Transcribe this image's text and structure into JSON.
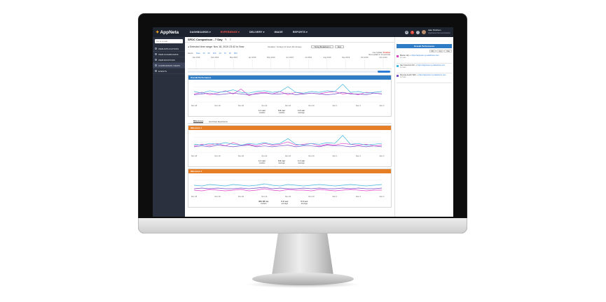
{
  "app": {
    "name": "AppNeta"
  },
  "nav": {
    "items": [
      {
        "label": "DASHBOARDS ▾",
        "active": false
      },
      {
        "label": "EXPERIENCE ▾",
        "active": true
      },
      {
        "label": "DELIVERY ▾",
        "active": false
      },
      {
        "label": "IMAGE",
        "active": false
      },
      {
        "label": "REPORTS ▾",
        "active": false
      }
    ],
    "user_name": "Alan Pinkham",
    "user_org": "AppNeta Demonstration"
  },
  "sidebar": {
    "search_placeholder": "Go to a web...",
    "items": [
      {
        "label": "WEB APPLICATIONS",
        "active": false
      },
      {
        "label": "WEB DASHBOARDS",
        "active": false
      },
      {
        "label": "WEB MONITORS",
        "active": false
      },
      {
        "label": "COMPARISON VIEWS",
        "active": true
      },
      {
        "label": "EVENTS",
        "active": false
      }
    ]
  },
  "main": {
    "title": "SFDC Comparison - 7 Day",
    "range_text": "◂ Selected time range: Nov 18, 2019 23:42 to Now",
    "duration": "Duration: 7d days 12 hours 29 minutes",
    "select_1": "Timing Breakdown ▾",
    "select_2": "Now",
    "live_label": "Live Update:",
    "live_value": "Enabled",
    "live_sub": "Next update in 14 seconds",
    "zoom_label": "Zoom:",
    "zoom_options": [
      "Now",
      "1h",
      "6h",
      "12h",
      "1d",
      "7d",
      "1h",
      "30d"
    ],
    "timeline_ticks": [
      "Jan 2019",
      "Feb 2019",
      "Mar 2019",
      "Apr 2019",
      "May 2019",
      "Jun 2019",
      "Jul 2019",
      "Aug 2019",
      "Sep 2019",
      "Oct 2019",
      "Nov 2019"
    ],
    "tabs": [
      "Milestones",
      "End User Experience"
    ],
    "chart_x_ticks": [
      "Nov 18",
      "Nov 19",
      "Nov 20",
      "Nov 21",
      "Nov 22",
      "Nov 23",
      "Dec 1",
      "Dec 2",
      "Dec 3"
    ]
  },
  "panels": [
    {
      "title": "Overall Performance",
      "color": "#2f7cc6",
      "stats": [
        {
          "value": "1.1 sec",
          "label": "median"
        },
        {
          "value": "0.9 sec",
          "label": "median"
        },
        {
          "value": "1.3 sec",
          "label": "average"
        }
      ]
    },
    {
      "title": "Milestone 1",
      "color": "#e57e25",
      "stats": [
        {
          "value": "1.1 sec",
          "label": "median"
        },
        {
          "value": "0.9 sec",
          "label": "average"
        },
        {
          "value": "1.1 sec",
          "label": "average"
        }
      ]
    },
    {
      "title": "Milestone 2",
      "color": "#e57e25",
      "stats": [
        {
          "value": "381.38 ms",
          "label": "median"
        },
        {
          "value": "0.2 sec",
          "label": "average"
        },
        {
          "value": "0.3 sec",
          "label": "average"
        }
      ]
    }
  ],
  "right_panel": {
    "title": "Overall Performance",
    "tabs": [
      "Min",
      "Avg",
      "Max"
    ],
    "rows": [
      {
        "color": "#e040c8",
        "name": "Boston HQ",
        "url": "https://appneta.my.salesforce.com",
        "value": "1.1 sec"
      },
      {
        "color": "#3fb6e0",
        "name": "San Francisco DC",
        "url": "https://appneta.my.salesforce.com",
        "value": "1.2 sec"
      },
      {
        "color": "#7b4fc9",
        "name": "Remote Austin WiFi",
        "url": "https://appneta.my.salesforce.com",
        "value": "1.2 sec"
      }
    ]
  },
  "chart_data": [
    {
      "type": "line",
      "title": "Overall Performance",
      "x": [
        "Nov 18",
        "Nov 19",
        "Nov 20",
        "Nov 21",
        "Nov 22",
        "Nov 23",
        "Dec 1",
        "Dec 2",
        "Dec 3"
      ],
      "ylim": [
        0,
        2.5
      ],
      "series": [
        {
          "name": "Boston HQ",
          "color": "#e040c8",
          "values": [
            1.0,
            1.2,
            0.9,
            1.1,
            1.4,
            1.0,
            1.6,
            0.8,
            1.1,
            1.2,
            1.0,
            1.3,
            0.9,
            1.2,
            1.0,
            1.1,
            1.0,
            1.2,
            1.3,
            1.0,
            1.1,
            0.9,
            1.2,
            1.1,
            1.0
          ]
        },
        {
          "name": "San Francisco DC",
          "color": "#3fb6e0",
          "values": [
            1.3,
            1.1,
            1.4,
            1.2,
            1.3,
            1.5,
            1.2,
            1.1,
            1.3,
            1.4,
            1.2,
            1.3,
            1.9,
            1.2,
            1.1,
            1.3,
            1.2,
            1.4,
            1.3,
            2.2,
            1.2,
            1.3,
            1.1,
            1.2,
            1.3
          ]
        },
        {
          "name": "Remote Austin WiFi",
          "color": "#7b4fc9",
          "values": [
            0.9,
            1.0,
            1.1,
            0.9,
            1.0,
            1.1,
            1.0,
            0.9,
            1.0,
            1.1,
            1.0,
            1.0,
            1.1,
            0.9,
            1.0,
            1.1,
            1.0,
            0.9,
            1.0,
            1.2,
            1.0,
            1.0,
            0.9,
            1.1,
            1.0
          ]
        }
      ]
    },
    {
      "type": "line",
      "title": "Milestone 1",
      "x": [
        "Nov 18",
        "Nov 19",
        "Nov 20",
        "Nov 21",
        "Nov 22",
        "Nov 23",
        "Dec 1",
        "Dec 2",
        "Dec 3"
      ],
      "ylim": [
        0,
        2.5
      ],
      "series": [
        {
          "name": "Boston HQ",
          "color": "#e040c8",
          "values": [
            0.8,
            1.0,
            0.9,
            1.1,
            0.8,
            1.2,
            0.9,
            1.0,
            0.8,
            1.1,
            0.9,
            1.0,
            1.3,
            0.9,
            1.0,
            1.1,
            0.8,
            1.0,
            0.9,
            1.1,
            1.0,
            0.9,
            1.0,
            0.8,
            0.9
          ]
        },
        {
          "name": "San Francisco DC",
          "color": "#3fb6e0",
          "values": [
            1.0,
            0.9,
            1.1,
            1.0,
            1.2,
            1.0,
            0.9,
            1.1,
            1.0,
            1.2,
            1.0,
            1.1,
            1.7,
            1.0,
            0.9,
            1.1,
            1.0,
            1.2,
            1.1,
            2.1,
            1.0,
            1.1,
            0.9,
            1.0,
            1.1
          ]
        },
        {
          "name": "Remote Austin WiFi",
          "color": "#7b4fc9",
          "values": [
            0.7,
            0.8,
            0.7,
            0.9,
            0.8,
            0.7,
            0.8,
            0.9,
            0.7,
            0.8,
            0.7,
            0.8,
            0.9,
            0.7,
            0.8,
            0.8,
            0.7,
            0.9,
            0.8,
            0.8,
            0.7,
            0.8,
            0.7,
            0.8,
            0.7
          ]
        }
      ]
    },
    {
      "type": "line",
      "title": "Milestone 2",
      "x": [
        "Nov 18",
        "Nov 19",
        "Nov 20",
        "Nov 21",
        "Nov 22",
        "Nov 23",
        "Dec 1",
        "Dec 2",
        "Dec 3"
      ],
      "ylim": [
        0,
        2.5
      ],
      "series": [
        {
          "name": "Boston HQ",
          "color": "#e040c8",
          "values": [
            0.4,
            0.3,
            0.5,
            0.4,
            0.3,
            0.4,
            0.5,
            0.3,
            0.4,
            0.6,
            0.4,
            0.3,
            0.5,
            0.4,
            0.4,
            0.3,
            0.5,
            0.4,
            0.3,
            0.4,
            0.5,
            0.4,
            0.3,
            0.4,
            0.4
          ]
        },
        {
          "name": "San Francisco DC",
          "color": "#3fb6e0",
          "values": [
            1.1,
            1.0,
            1.2,
            1.1,
            1.0,
            1.2,
            1.1,
            1.0,
            1.1,
            1.3,
            1.1,
            1.0,
            1.2,
            1.1,
            1.0,
            1.1,
            1.2,
            1.1,
            1.0,
            1.1,
            1.2,
            1.1,
            1.0,
            1.1,
            1.2
          ]
        },
        {
          "name": "Remote Austin WiFi",
          "color": "#7b4fc9",
          "values": [
            0.6,
            0.7,
            0.6,
            0.7,
            0.6,
            0.6,
            0.7,
            0.6,
            0.7,
            0.8,
            0.6,
            0.7,
            0.6,
            0.6,
            0.7,
            0.6,
            0.7,
            0.6,
            0.6,
            0.7,
            0.6,
            0.7,
            0.6,
            0.6,
            0.7
          ]
        }
      ]
    }
  ]
}
